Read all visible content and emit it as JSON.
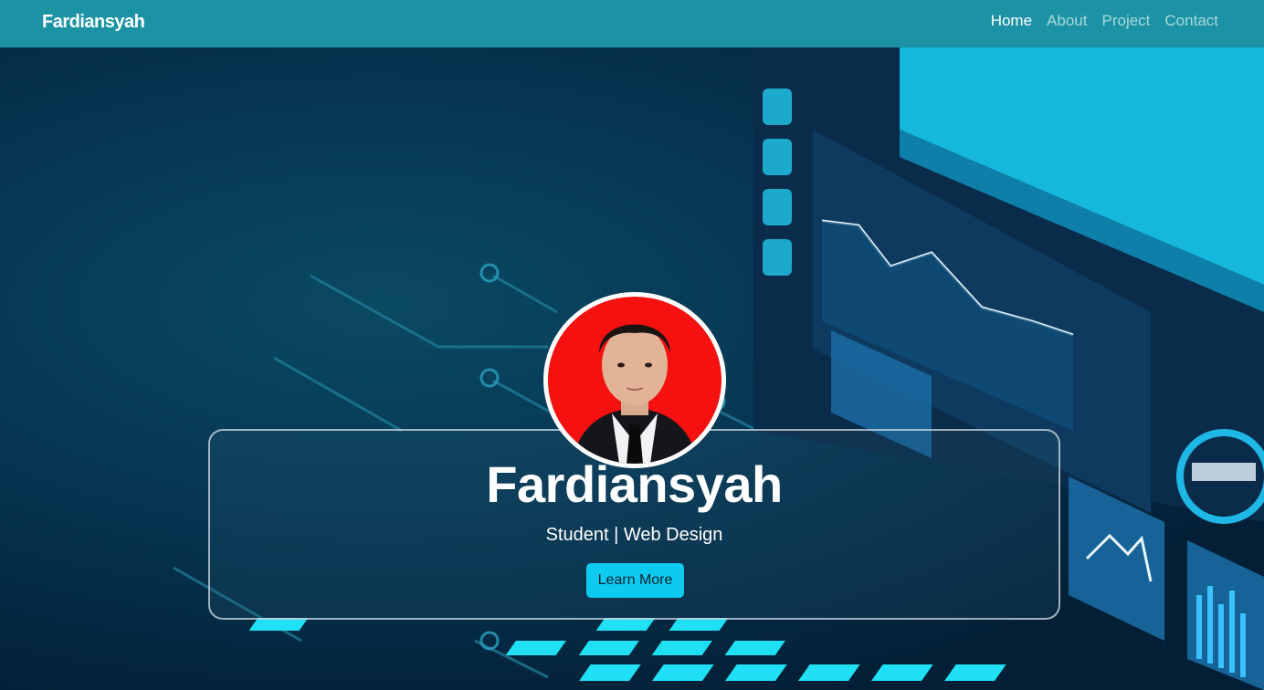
{
  "navbar": {
    "brand": "Fardiansyah",
    "links": [
      {
        "label": "Home",
        "active": true
      },
      {
        "label": "About",
        "active": false
      },
      {
        "label": "Project",
        "active": false
      },
      {
        "label": "Contact",
        "active": false
      }
    ]
  },
  "hero": {
    "name": "Fardiansyah",
    "tagline": "Student | Web Design",
    "cta_label": "Learn More"
  },
  "colors": {
    "navbar": "#1b93a4",
    "cta": "#0dcaf0",
    "avatar_bg": "#f4110f"
  }
}
